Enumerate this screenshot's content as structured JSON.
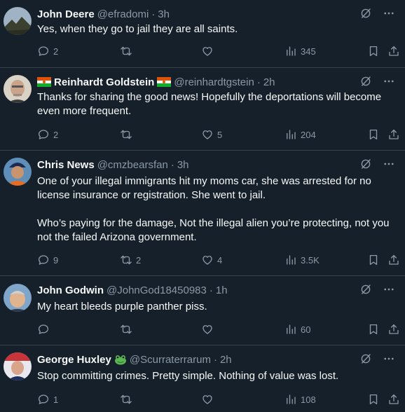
{
  "tweets": [
    {
      "name": "John Deere",
      "handle": "@efradomi",
      "time": "3h",
      "text": "Yes, when they go to jail they are all saints.",
      "replies": "2",
      "retweets": "",
      "likes": "",
      "views": "345"
    },
    {
      "name": "Reinhardt Goldstein",
      "handle": "@reinhardtgstein",
      "time": "2h",
      "text": "Thanks for sharing the good news! Hopefully the deportations will become even more frequent.",
      "replies": "2",
      "retweets": "",
      "likes": "5",
      "views": "204"
    },
    {
      "name": "Chris News",
      "handle": "@cmzbearsfan",
      "time": "3h",
      "text": "One of your illegal immigrants hit my moms car, she was arrested for no license insurance or registration. She went to jail.\n\nWho’s paying for the damage, Not the illegal alien you’re protecting, not you not the failed Arizona government.",
      "replies": "9",
      "retweets": "2",
      "likes": "4",
      "views": "3.5K"
    },
    {
      "name": "John Godwin",
      "handle": "@JohnGod18450983",
      "time": "1h",
      "text": "My heart bleeds purple panther piss.",
      "replies": "",
      "retweets": "",
      "likes": "",
      "views": "60"
    },
    {
      "name": "George Huxley",
      "handle": "@Scurraterrarum",
      "time": "2h",
      "text": "Stop committing crimes. Pretty simple. Nothing of value was lost.",
      "replies": "1",
      "retweets": "",
      "likes": "",
      "views": "108"
    }
  ],
  "separator": "·",
  "icons": {
    "reply": "reply-icon",
    "retweet": "retweet-icon",
    "like": "heart-icon",
    "views": "views-icon",
    "bookmark": "bookmark-icon",
    "share": "share-icon",
    "grok": "grok-icon",
    "more": "more-icon"
  },
  "colors": {
    "background": "#15202b",
    "text": "#f7f9f9",
    "secondary": "#8b98a5",
    "border": "#38444d"
  }
}
